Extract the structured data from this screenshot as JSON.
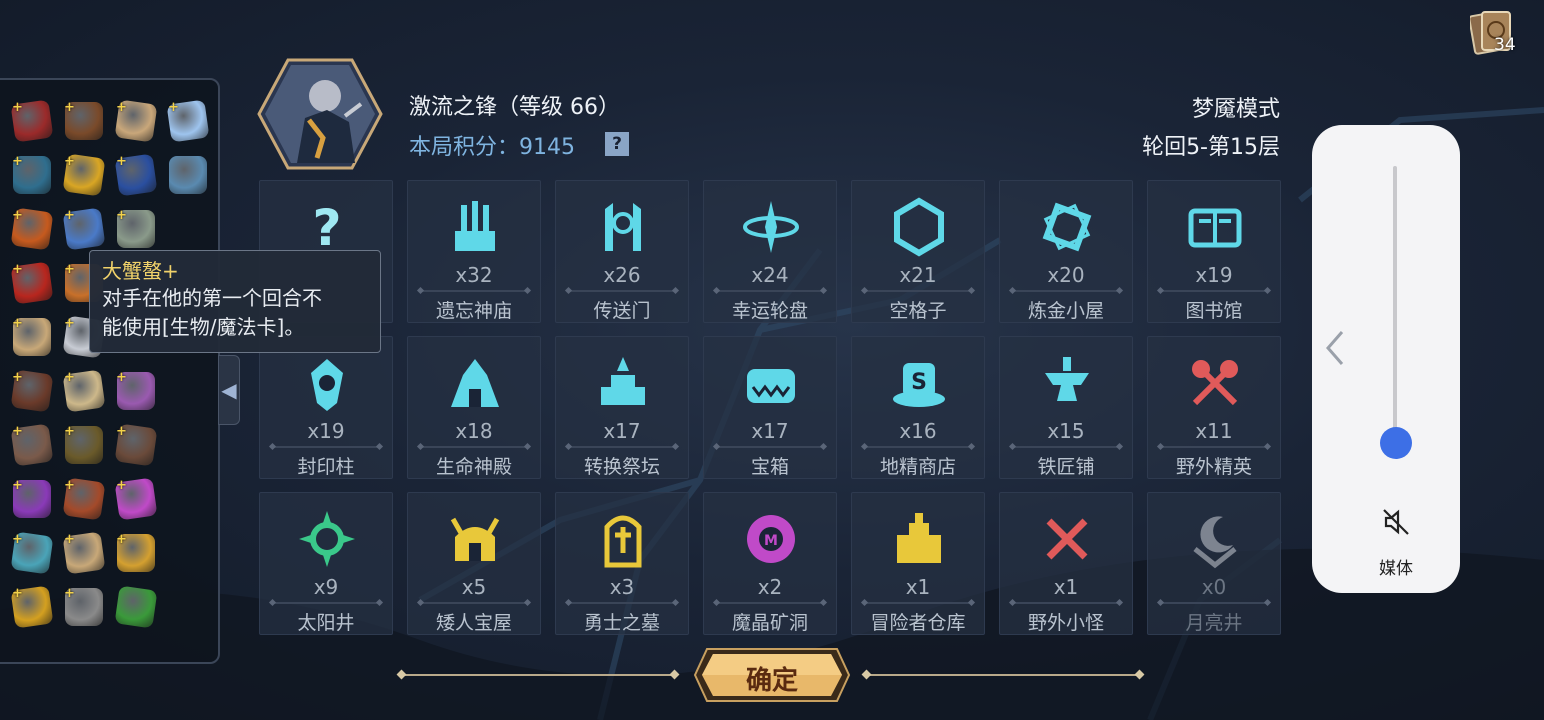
{
  "header": {
    "player_name": "激流之锋（等级 66）",
    "score_label": "本局积分：9145",
    "help": "?",
    "mode": "梦魇模式",
    "floor": "轮回5-第15层"
  },
  "deck": {
    "count": "34"
  },
  "tooltip": {
    "title": "大蟹螯+",
    "line1": "对手在他的第一个回合不",
    "line2": "能使用[生物/魔法卡]。"
  },
  "inventory": {
    "items": [
      {
        "icon": "red-book-icon",
        "color": "#9b2a2a",
        "plus": "+"
      },
      {
        "icon": "brown-book-icon",
        "color": "#7a4a2a",
        "plus": "+"
      },
      {
        "icon": "scroll-seal-icon",
        "color": "#c9a77a",
        "plus": "+"
      },
      {
        "icon": "flower-icon",
        "color": "#9ec4ee",
        "plus": "+"
      },
      {
        "icon": "blue-cloth-icon",
        "color": "#2f6e8e",
        "plus": "+"
      },
      {
        "icon": "gold-bars-icon",
        "color": "#d9a624",
        "plus": "+"
      },
      {
        "icon": "mystery-card-icon",
        "color": "#2a4fa0",
        "plus": "+"
      },
      {
        "icon": "treasure-chest-icon",
        "color": "#5a8ab0",
        "plus": ""
      },
      {
        "icon": "torch-icon",
        "color": "#c65a1e",
        "plus": "+"
      },
      {
        "icon": "moon-stone-icon",
        "color": "#4a7ac8",
        "plus": "+"
      },
      {
        "icon": "bone-scroll-icon",
        "color": "#8a9a8a",
        "plus": "+"
      },
      {
        "icon": "empty-slot",
        "color": "transparent",
        "plus": ""
      },
      {
        "icon": "crab-claw-icon",
        "color": "#b8261e",
        "plus": "+"
      },
      {
        "icon": "crab-icon",
        "color": "#c8702a",
        "plus": "+"
      },
      {
        "icon": "empty-slot",
        "color": "transparent",
        "plus": ""
      },
      {
        "icon": "empty-slot",
        "color": "transparent",
        "plus": ""
      },
      {
        "icon": "map-scroll-icon",
        "color": "#c8a878",
        "plus": "+"
      },
      {
        "icon": "amulet-icon",
        "color": "#c8ccd4",
        "plus": "+"
      },
      {
        "icon": "empty-slot",
        "color": "transparent",
        "plus": ""
      },
      {
        "icon": "empty-slot",
        "color": "transparent",
        "plus": ""
      },
      {
        "icon": "bagpipe-icon",
        "color": "#6a3a2a",
        "plus": "+"
      },
      {
        "icon": "sack-icon",
        "color": "#cdb88a",
        "plus": "+"
      },
      {
        "icon": "purple-box-icon",
        "color": "#9a5ab0",
        "plus": "+"
      },
      {
        "icon": "empty-slot",
        "color": "transparent",
        "plus": ""
      },
      {
        "icon": "horn-icon",
        "color": "#7a5a4a",
        "plus": "+"
      },
      {
        "icon": "leather-map-icon",
        "color": "#6a5a2a",
        "plus": "+"
      },
      {
        "icon": "glove-icon",
        "color": "#6a4a3a",
        "plus": "+"
      },
      {
        "icon": "empty-slot",
        "color": "transparent",
        "plus": ""
      },
      {
        "icon": "purple-orb-icon",
        "color": "#8a3ab8",
        "plus": "+"
      },
      {
        "icon": "hood-icon",
        "color": "#a44a2a",
        "plus": "+"
      },
      {
        "icon": "potion-icon",
        "color": "#c04ac8",
        "plus": "+"
      },
      {
        "icon": "empty-slot",
        "color": "transparent",
        "plus": ""
      },
      {
        "icon": "blue-bottle-icon",
        "color": "#4aa4b8",
        "plus": "+"
      },
      {
        "icon": "parchment-icon",
        "color": "#c8a878",
        "plus": "+"
      },
      {
        "icon": "gold-coin-icon",
        "color": "#d4a030",
        "plus": "+"
      },
      {
        "icon": "empty-slot",
        "color": "transparent",
        "plus": ""
      },
      {
        "icon": "gauntlet-icon",
        "color": "#d4a020",
        "plus": "+"
      },
      {
        "icon": "spike-collar-icon",
        "color": "#8a8a8a",
        "plus": "+"
      },
      {
        "icon": "green-bowl-icon",
        "color": "#3a9a3a",
        "plus": ""
      },
      {
        "icon": "empty-slot",
        "color": "transparent",
        "plus": ""
      }
    ]
  },
  "rooms": [
    {
      "name": "",
      "count": "",
      "icon": "question-icon",
      "color": "#9fe8f2",
      "dim": false
    },
    {
      "name": "遗忘神庙",
      "count": "x32",
      "icon": "ruins-icon",
      "color": "#5fd8e8",
      "dim": false
    },
    {
      "name": "传送门",
      "count": "x26",
      "icon": "portal-icon",
      "color": "#5fd8e8",
      "dim": false
    },
    {
      "name": "幸运轮盘",
      "count": "x24",
      "icon": "wheel-icon",
      "color": "#5fd8e8",
      "dim": false
    },
    {
      "name": "空格子",
      "count": "x21",
      "icon": "hexagon-icon",
      "color": "#5fd8e8",
      "dim": false
    },
    {
      "name": "炼金小屋",
      "count": "x20",
      "icon": "alchemy-icon",
      "color": "#5fd8e8",
      "dim": false
    },
    {
      "name": "图书馆",
      "count": "x19",
      "icon": "library-icon",
      "color": "#5fd8e8",
      "dim": false
    },
    {
      "name": "封印柱",
      "count": "x19",
      "icon": "seal-pillar-icon",
      "color": "#5fd8e8",
      "dim": false
    },
    {
      "name": "生命神殿",
      "count": "x18",
      "icon": "life-temple-icon",
      "color": "#5fd8e8",
      "dim": false
    },
    {
      "name": "转换祭坛",
      "count": "x17",
      "icon": "altar-icon",
      "color": "#5fd8e8",
      "dim": false
    },
    {
      "name": "宝箱",
      "count": "x17",
      "icon": "chest-icon",
      "color": "#5fd8e8",
      "dim": false
    },
    {
      "name": "地精商店",
      "count": "x16",
      "icon": "shop-icon",
      "color": "#5fd8e8",
      "dim": false
    },
    {
      "name": "铁匠铺",
      "count": "x15",
      "icon": "anvil-icon",
      "color": "#5fd8e8",
      "dim": false
    },
    {
      "name": "野外精英",
      "count": "x11",
      "icon": "elite-axes-icon",
      "color": "#e05a5a",
      "dim": false
    },
    {
      "name": "太阳井",
      "count": "x9",
      "icon": "sun-well-icon",
      "color": "#3ac88a",
      "dim": false
    },
    {
      "name": "矮人宝屋",
      "count": "x5",
      "icon": "dwarf-helmet-icon",
      "color": "#e8c83a",
      "dim": false
    },
    {
      "name": "勇士之墓",
      "count": "x3",
      "icon": "tomb-icon",
      "color": "#e8c83a",
      "dim": false
    },
    {
      "name": "魔晶矿洞",
      "count": "x2",
      "icon": "crystal-mine-icon",
      "color": "#c04ac8",
      "dim": false
    },
    {
      "name": "冒险者仓库",
      "count": "x1",
      "icon": "warehouse-icon",
      "color": "#e8c83a",
      "dim": false
    },
    {
      "name": "野外小怪",
      "count": "x1",
      "icon": "crossed-swords-icon",
      "color": "#e05a5a",
      "dim": false
    },
    {
      "name": "月亮井",
      "count": "x0",
      "icon": "moon-well-icon",
      "color": "#c8ccd4",
      "dim": true
    }
  ],
  "confirm": {
    "label": "确定"
  },
  "volume": {
    "label": "媒体",
    "level": 0.05
  }
}
